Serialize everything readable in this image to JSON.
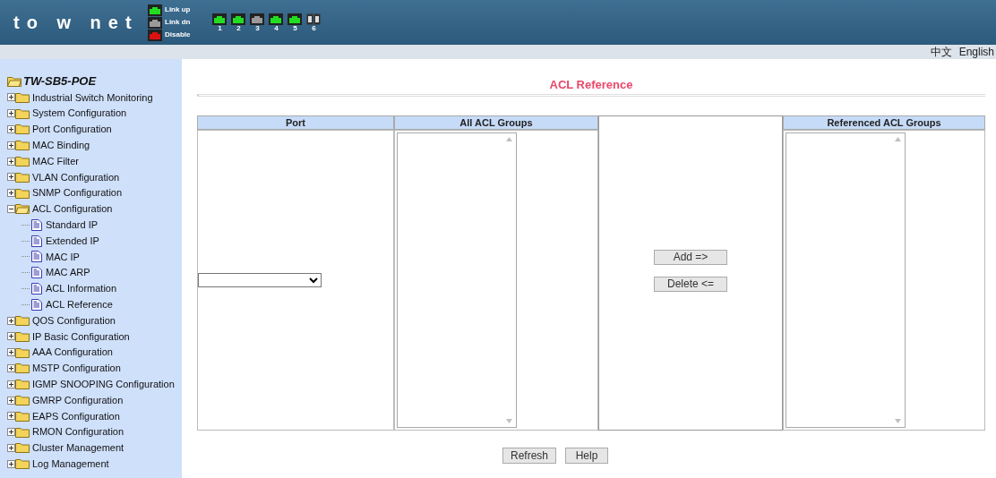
{
  "header": {
    "logo": "to w net",
    "legend": [
      {
        "label": "Link up",
        "kind": "up"
      },
      {
        "label": "Link dn",
        "kind": "down"
      },
      {
        "label": "Disable",
        "kind": "disabled"
      }
    ],
    "ports": [
      {
        "label": "1",
        "kind": "up"
      },
      {
        "label": "2",
        "kind": "up"
      },
      {
        "label": "3",
        "kind": "down"
      },
      {
        "label": "4",
        "kind": "up"
      },
      {
        "label": "5",
        "kind": "up"
      },
      {
        "label": "6",
        "kind": "fiber"
      }
    ]
  },
  "languages": [
    {
      "label": "中文"
    },
    {
      "label": "English"
    }
  ],
  "sidebar": {
    "root": "TW-SB5-POE",
    "items": [
      {
        "label": "Industrial Switch Monitoring",
        "expanded": false
      },
      {
        "label": "System Configuration",
        "expanded": false
      },
      {
        "label": "Port Configuration",
        "expanded": false
      },
      {
        "label": "MAC Binding",
        "expanded": false
      },
      {
        "label": "MAC Filter",
        "expanded": false
      },
      {
        "label": "VLAN Configuration",
        "expanded": false
      },
      {
        "label": "SNMP Configuration",
        "expanded": false
      },
      {
        "label": "ACL Configuration",
        "expanded": true,
        "children": [
          {
            "label": "Standard IP"
          },
          {
            "label": "Extended IP"
          },
          {
            "label": "MAC IP"
          },
          {
            "label": "MAC ARP"
          },
          {
            "label": "ACL Information"
          },
          {
            "label": "ACL Reference"
          }
        ]
      },
      {
        "label": "QOS Configuration",
        "expanded": false
      },
      {
        "label": "IP Basic Configuration",
        "expanded": false
      },
      {
        "label": "AAA Configuration",
        "expanded": false
      },
      {
        "label": "MSTP Configuration",
        "expanded": false
      },
      {
        "label": "IGMP SNOOPING Configuration",
        "expanded": false
      },
      {
        "label": "GMRP Configuration",
        "expanded": false
      },
      {
        "label": "EAPS Configuration",
        "expanded": false
      },
      {
        "label": "RMON Configuration",
        "expanded": false
      },
      {
        "label": "Cluster Management",
        "expanded": false
      },
      {
        "label": "Log Management",
        "expanded": false
      }
    ]
  },
  "main": {
    "title": "ACL Reference",
    "columns": [
      "Port",
      "All ACL Groups",
      "Referenced ACL Groups"
    ],
    "add_button": "Add =>",
    "delete_button": "Delete <=",
    "buttons": [
      "Refresh",
      "Help"
    ]
  }
}
